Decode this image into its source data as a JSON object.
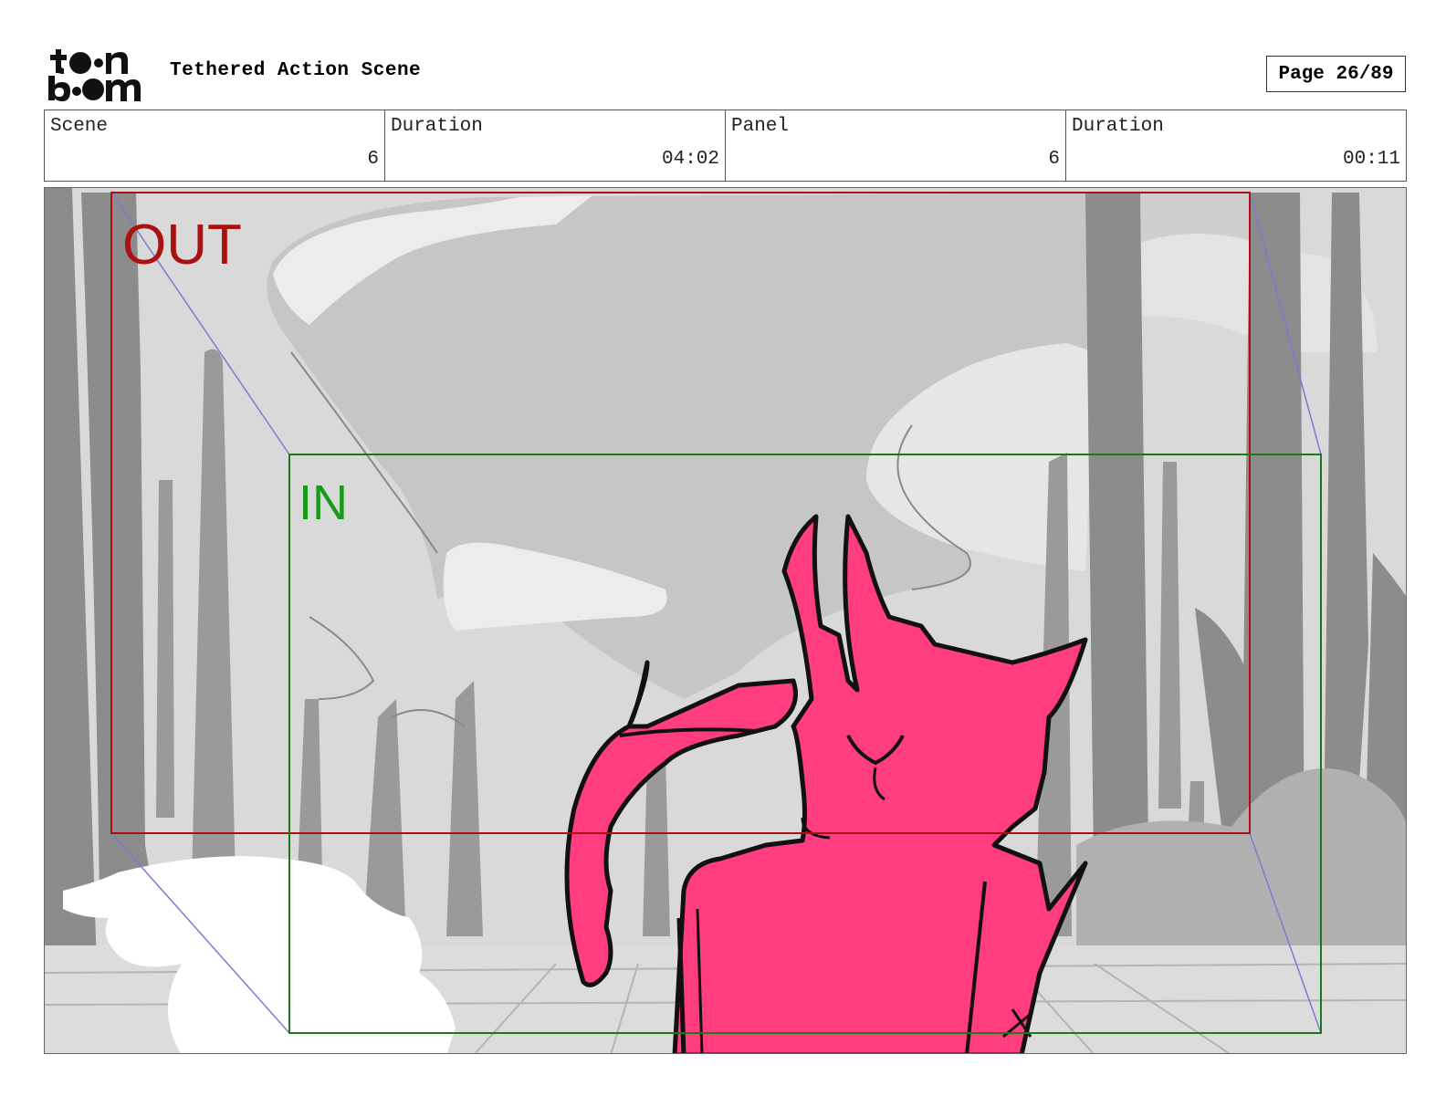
{
  "header": {
    "logo_text": "toon boom",
    "title": "Tethered Action Scene",
    "page_label": "Page 26/89"
  },
  "info": {
    "scene_label": "Scene",
    "scene_value": "6",
    "scene_duration_label": "Duration",
    "scene_duration_value": "04:02",
    "panel_label": "Panel",
    "panel_value": "6",
    "panel_duration_label": "Duration",
    "panel_duration_value": "00:11"
  },
  "frames": {
    "out_label": "OUT",
    "in_label": "IN",
    "out_color": "#aa1111",
    "in_color": "#1a8a1a"
  },
  "colors": {
    "character_fill": "#ff3d7f",
    "background_gray": "#c8c8c8"
  }
}
